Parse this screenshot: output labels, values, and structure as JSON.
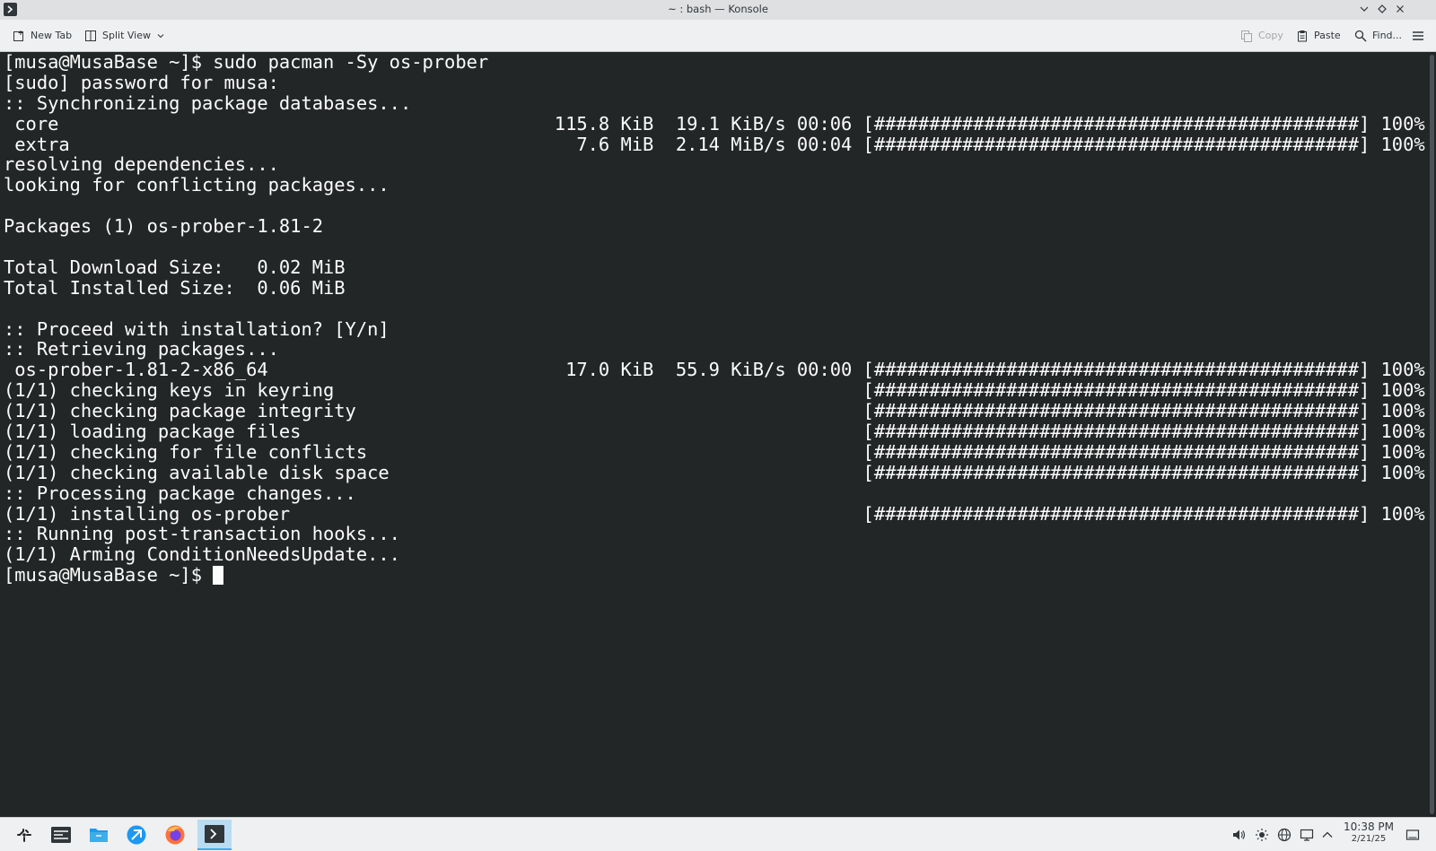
{
  "window": {
    "title": "~ : bash — Konsole",
    "buttons": [
      "minimize",
      "maximize",
      "close"
    ]
  },
  "toolbar": {
    "new_tab_label": "New Tab",
    "split_view_label": "Split View",
    "copy_label": "Copy",
    "paste_label": "Paste",
    "find_label": "Find..."
  },
  "terminal": {
    "lines": [
      "[musa@MusaBase ~]$ sudo pacman -Sy os-prober",
      "[sudo] password for musa:",
      ":: Synchronizing package databases...",
      " core                                             115.8 KiB  19.1 KiB/s 00:06 [############################################] 100%",
      " extra                                              7.6 MiB  2.14 MiB/s 00:04 [############################################] 100%",
      "resolving dependencies...",
      "looking for conflicting packages...",
      "",
      "Packages (1) os-prober-1.81-2",
      "",
      "Total Download Size:   0.02 MiB",
      "Total Installed Size:  0.06 MiB",
      "",
      ":: Proceed with installation? [Y/n]",
      ":: Retrieving packages...",
      " os-prober-1.81-2-x86_64                           17.0 KiB  55.9 KiB/s 00:00 [############################################] 100%",
      "(1/1) checking keys in keyring                                                [############################################] 100%",
      "(1/1) checking package integrity                                              [############################################] 100%",
      "(1/1) loading package files                                                   [############################################] 100%",
      "(1/1) checking for file conflicts                                             [############################################] 100%",
      "(1/1) checking available disk space                                           [############################################] 100%",
      ":: Processing package changes...",
      "(1/1) installing os-prober                                                    [############################################] 100%",
      ":: Running post-transaction hooks...",
      "(1/1) Arming ConditionNeedsUpdate..."
    ],
    "prompt": "[musa@MusaBase ~]$"
  },
  "taskbar": {
    "apps": [
      "application-launcher-icon",
      "system-monitor-icon",
      "file-manager-icon",
      "discover-icon",
      "firefox-icon",
      "konsole-icon"
    ],
    "clock_time": "10:38 PM",
    "clock_date": "2/21/25"
  },
  "colors": {
    "terminal_bg": "#232627",
    "terminal_fg": "#fcfcfc",
    "chrome_bg": "#eff0f1",
    "accent": "#3daee9"
  }
}
